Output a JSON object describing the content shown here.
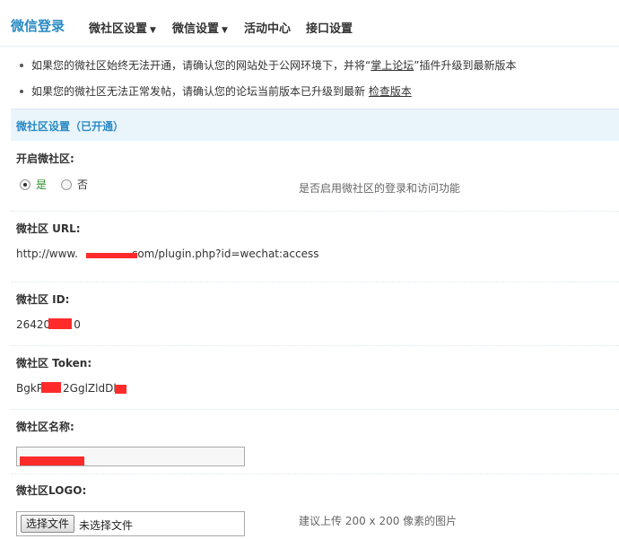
{
  "brand": "微信登录",
  "nav": [
    {
      "label": "微社区设置",
      "caret": "▼"
    },
    {
      "label": "微信设置",
      "caret": "▼"
    },
    {
      "label": "活动中心",
      "caret": ""
    },
    {
      "label": "接口设置",
      "caret": ""
    }
  ],
  "tips": [
    {
      "before": "如果您的微社区始终无法开通，请确认您的网站处于公网环境下，并将“",
      "link": "掌上论坛",
      "after": "”插件升级到最新版本"
    },
    {
      "before": "如果您的微社区无法正常发帖，请确认您的论坛当前版本已升级到最新",
      "link": "检查版本",
      "after": ""
    }
  ],
  "section_title": "微社区设置（已开通）",
  "enable": {
    "label": "开启微社区:",
    "options": [
      {
        "label": "是",
        "checked": true
      },
      {
        "label": "否",
        "checked": false
      }
    ],
    "hint": "是否启用微社区的登录和访问功能"
  },
  "url": {
    "label": "微社区 URL:",
    "value_before": "http://www.",
    "value_after": ".com/plugin.php?id=wechat:access"
  },
  "id": {
    "label": "微社区 ID:",
    "value_before": "26420",
    "value_after": "0"
  },
  "token": {
    "label": "微社区 Token:",
    "value_before": "BgkP",
    "value_after": "2GglZldDk"
  },
  "name": {
    "label": "微社区名称:",
    "value": ""
  },
  "logo": {
    "label": "微社区LOGO:",
    "button": "选择文件",
    "status": "未选择文件",
    "hint": "建议上传 200 x 200 像素的图片"
  },
  "colors": {
    "brand": "#2a8bc4",
    "redaction": "#ff2b2b",
    "section_bg": "#eaf4fb",
    "yes": "#2e8b2e"
  }
}
